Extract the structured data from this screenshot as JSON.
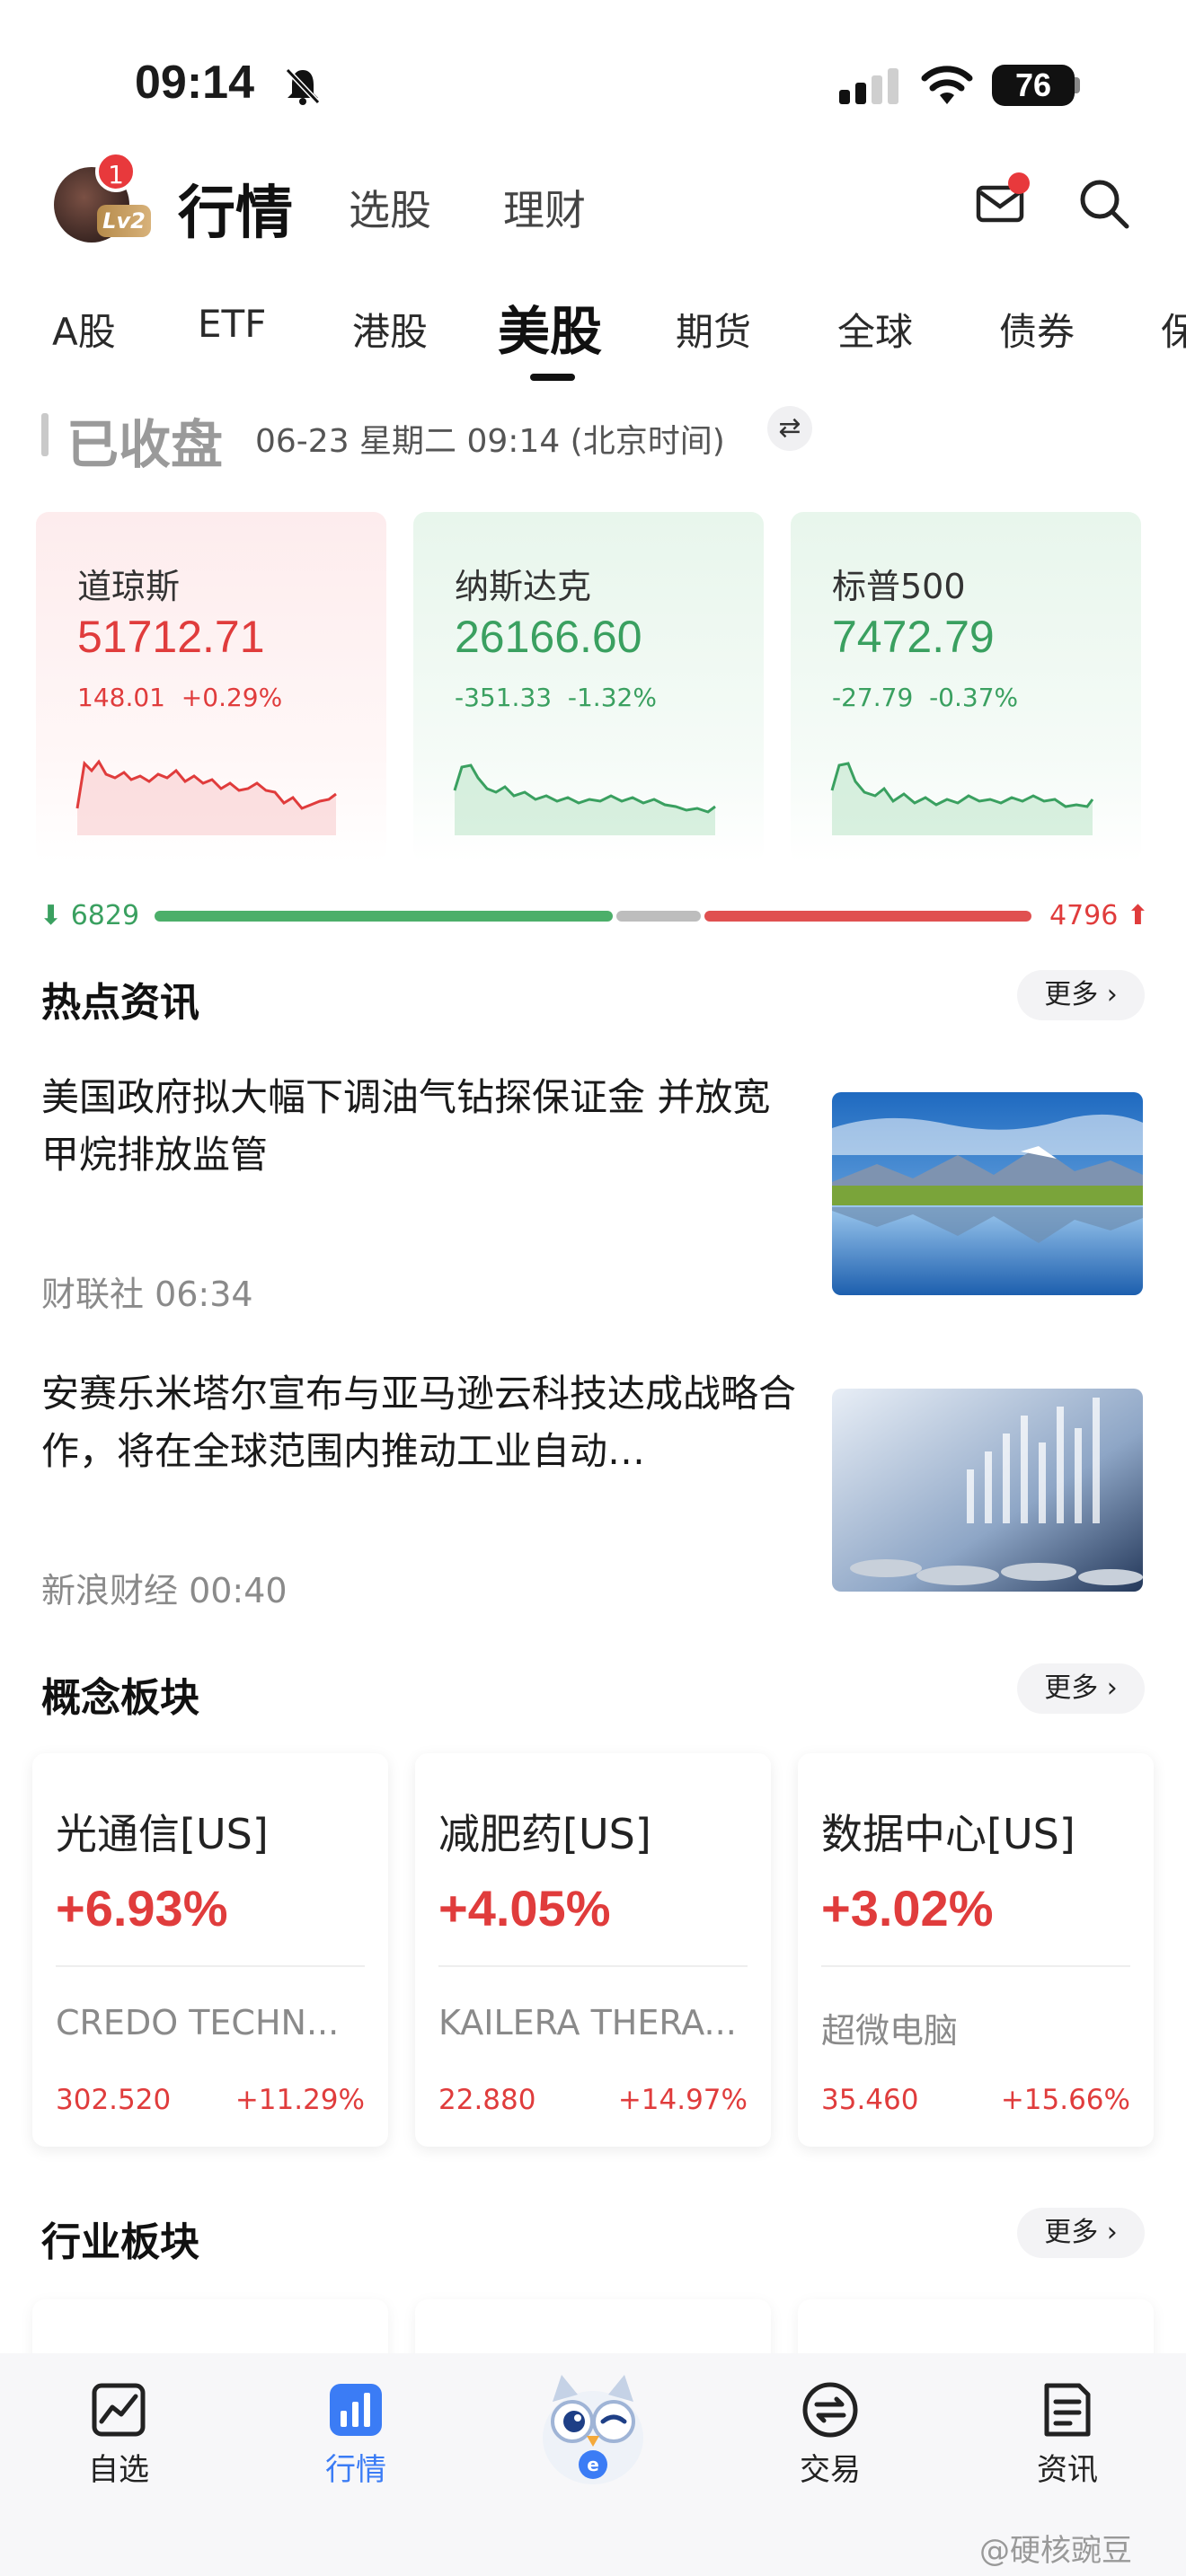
{
  "status_bar": {
    "time": "09:14",
    "battery": "76"
  },
  "header": {
    "avatar_badge_count": "1",
    "level": "Lv2",
    "tabs": [
      {
        "label": "行情",
        "active": true
      },
      {
        "label": "选股",
        "active": false
      },
      {
        "label": "理财",
        "active": false
      }
    ]
  },
  "market_tabs": [
    {
      "label": "A股",
      "active": false
    },
    {
      "label": "ETF",
      "active": false
    },
    {
      "label": "港股",
      "active": false
    },
    {
      "label": "美股",
      "active": true
    },
    {
      "label": "期货",
      "active": false
    },
    {
      "label": "全球",
      "active": false
    },
    {
      "label": "债券",
      "active": false
    },
    {
      "label": "保",
      "active": false
    }
  ],
  "market_status": {
    "label": "已收盘",
    "time": "06-23 星期二 09:14 (北京时间)"
  },
  "indices": [
    {
      "name": "道琼斯",
      "value": "51712.71",
      "change": "148.01",
      "change_pct": "+0.29%",
      "trend": "up"
    },
    {
      "name": "纳斯达克",
      "value": "26166.60",
      "change": "-351.33",
      "change_pct": "-1.32%",
      "trend": "down"
    },
    {
      "name": "标普500",
      "value": "7472.79",
      "change": "-27.79",
      "change_pct": "-0.37%",
      "trend": "down"
    }
  ],
  "breadth": {
    "down": "6829",
    "up": "4796",
    "colors": {
      "down": "#4caf6a",
      "flat": "#bdbdbd",
      "up": "#e05050"
    }
  },
  "hot_news": {
    "title": "热点资讯",
    "more": "更多",
    "items": [
      {
        "title": "美国政府拟大幅下调油气钻探保证金 并放宽甲烷排放监管",
        "meta": "财联社 06:34",
        "thumb": "mountain-lake-image"
      },
      {
        "title": "安赛乐米塔尔宣布与亚马逊云科技达成战略合作，将在全球范围内推动工业自动…",
        "meta": "新浪财经 00:40",
        "thumb": "finance-chart-image"
      }
    ]
  },
  "concepts": {
    "title": "概念板块",
    "more": "更多",
    "items": [
      {
        "name": "光通信[US]",
        "pct": "+6.93%",
        "stock": "CREDO TECHN...",
        "price": "302.520",
        "chg": "+11.29%"
      },
      {
        "name": "减肥药[US]",
        "pct": "+4.05%",
        "stock": "KAILERA THERA...",
        "price": "22.880",
        "chg": "+14.97%"
      },
      {
        "name": "数据中心[US]",
        "pct": "+3.02%",
        "stock": "超微电脑",
        "price": "35.460",
        "chg": "+15.66%"
      }
    ]
  },
  "industries": {
    "title": "行业板块",
    "more": "更多"
  },
  "bottom_nav": [
    {
      "label": "自选",
      "icon": "watchlist-chart-icon",
      "active": false
    },
    {
      "label": "行情",
      "icon": "market-bar-icon",
      "active": true
    },
    {
      "label": "",
      "icon": "owl-mascot-icon",
      "active": false
    },
    {
      "label": "交易",
      "icon": "trade-swap-icon",
      "active": false
    },
    {
      "label": "资讯",
      "icon": "news-doc-icon",
      "active": false
    }
  ],
  "watermark": "@硬核豌豆"
}
